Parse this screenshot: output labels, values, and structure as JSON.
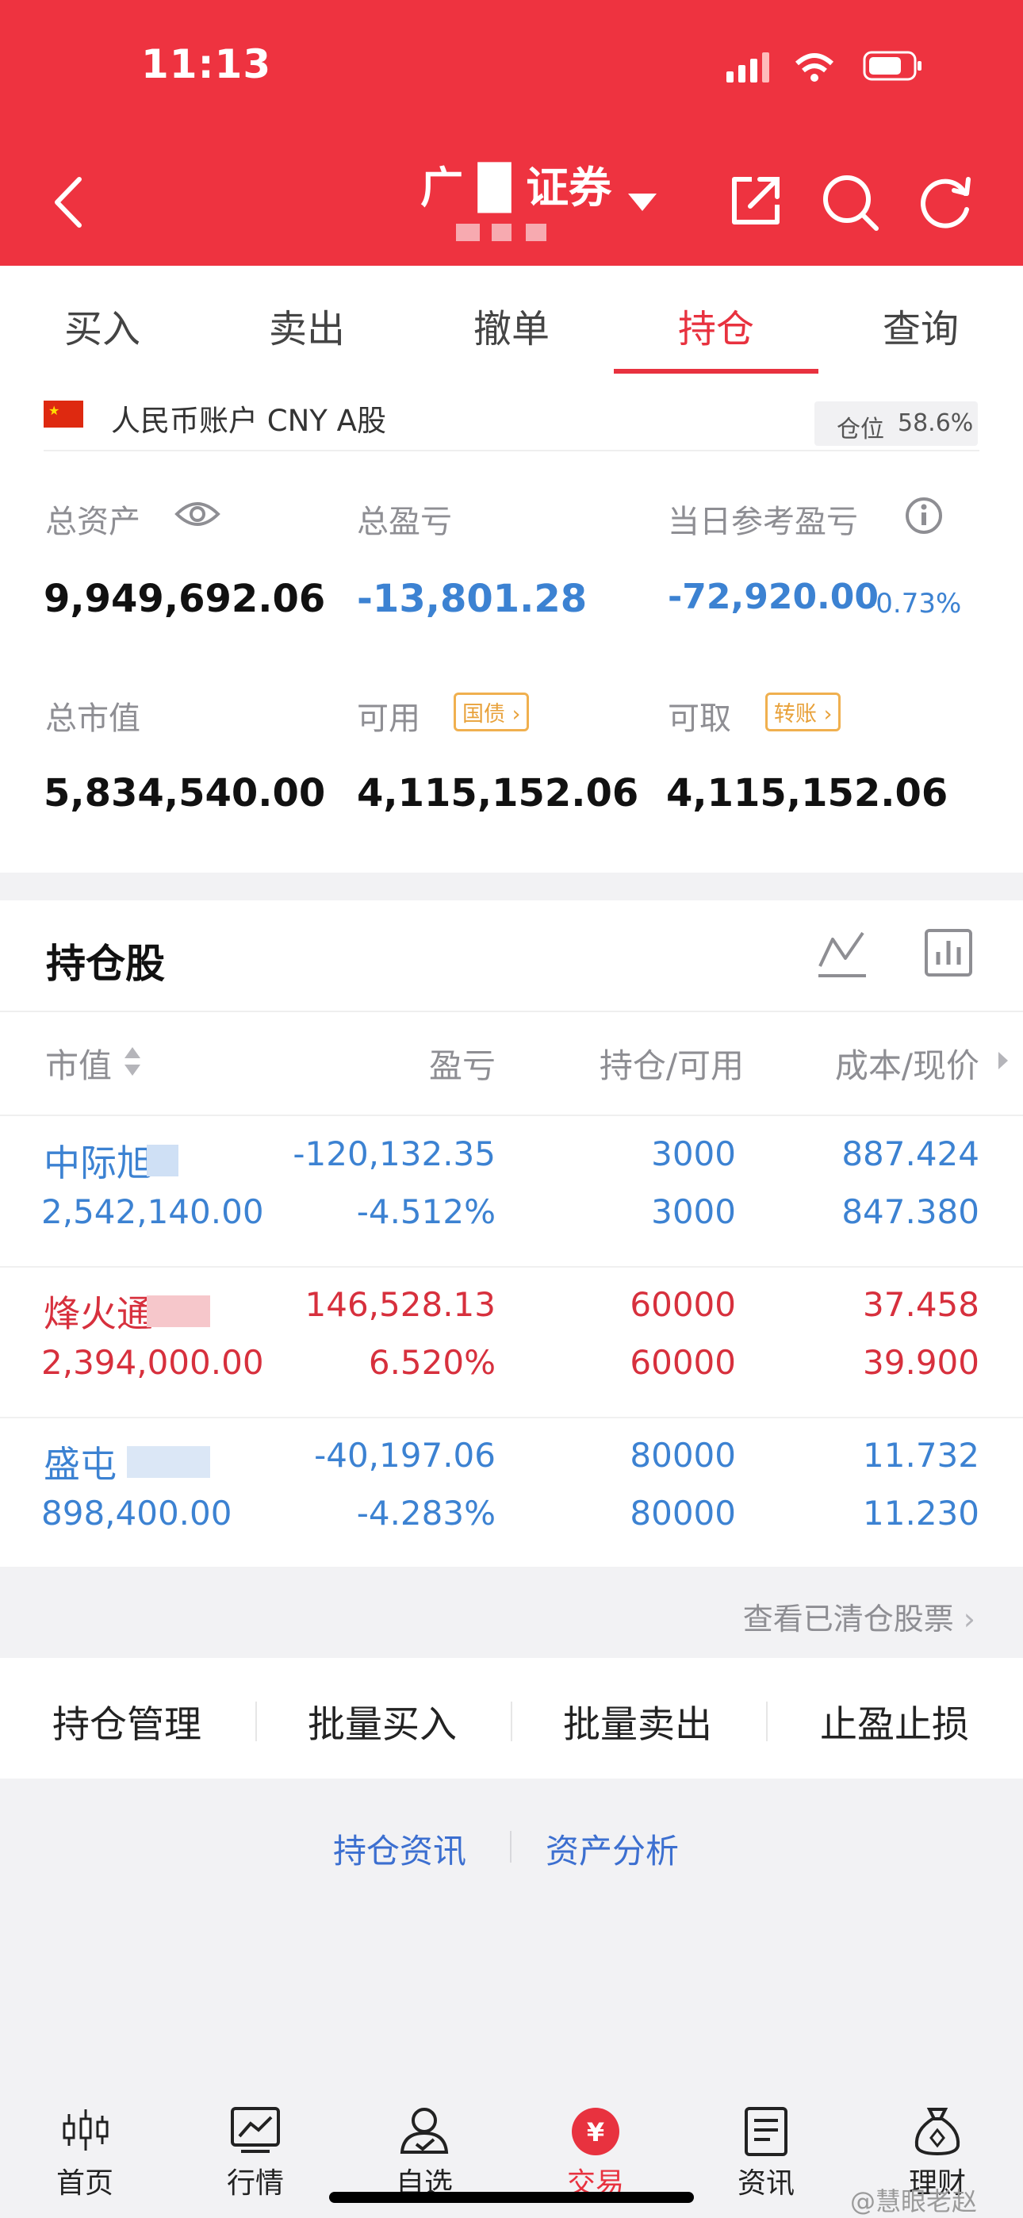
{
  "status": {
    "time": "11:13"
  },
  "header": {
    "title": "广 █ 证券"
  },
  "tabs": [
    {
      "label": "买入",
      "active": false
    },
    {
      "label": "卖出",
      "active": false
    },
    {
      "label": "撤单",
      "active": false
    },
    {
      "label": "持仓",
      "active": true
    },
    {
      "label": "查询",
      "active": false
    }
  ],
  "account": {
    "label": "人民币账户 CNY A股",
    "position_label": "仓位",
    "position_value": "58.6%"
  },
  "metrics": {
    "total_assets_label": "总资产",
    "total_assets": "9,949,692.06",
    "total_pnl_label": "总盈亏",
    "total_pnl": "-13,801.28",
    "daily_pnl_label": "当日参考盈亏",
    "daily_pnl": "-72,920.00",
    "daily_pnl_pct": "-0.73%",
    "market_value_label": "总市值",
    "market_value": "5,834,540.00",
    "available_label": "可用",
    "available_tag": "国债",
    "available": "4,115,152.06",
    "withdrawable_label": "可取",
    "withdrawable_tag": "转账",
    "withdrawable": "4,115,152.06"
  },
  "holdings": {
    "title": "持仓股",
    "columns": [
      "市值",
      "盈亏",
      "持仓/可用",
      "成本/现价"
    ],
    "rows": [
      {
        "name": "中际旭",
        "market_value": "2,542,140.00",
        "pnl": "-120,132.35",
        "pnl_pct": "-4.512%",
        "position": "3000",
        "available": "3000",
        "cost": "887.424",
        "price": "847.380",
        "trend": "down"
      },
      {
        "name": "烽火通",
        "market_value": "2,394,000.00",
        "pnl": "146,528.13",
        "pnl_pct": "6.520%",
        "position": "60000",
        "available": "60000",
        "cost": "37.458",
        "price": "39.900",
        "trend": "up"
      },
      {
        "name": "盛屯",
        "market_value": "898,400.00",
        "pnl": "-40,197.06",
        "pnl_pct": "-4.283%",
        "position": "80000",
        "available": "80000",
        "cost": "11.732",
        "price": "11.230",
        "trend": "down"
      }
    ],
    "view_cleared": "查看已清仓股票"
  },
  "actions": [
    "持仓管理",
    "批量买入",
    "批量卖出",
    "止盈止损"
  ],
  "links": [
    "持仓资讯",
    "资产分析"
  ],
  "nav": [
    {
      "label": "首页",
      "icon": "home-candlestick-icon"
    },
    {
      "label": "行情",
      "icon": "market-chart-icon"
    },
    {
      "label": "自选",
      "icon": "watchlist-person-icon"
    },
    {
      "label": "交易",
      "icon": "trade-yuan-icon",
      "active": true
    },
    {
      "label": "资讯",
      "icon": "news-doc-icon"
    },
    {
      "label": "理财",
      "icon": "wealth-bag-icon"
    }
  ],
  "watermark": "@慧眼老赵",
  "colors": {
    "brand_red": "#ee3340",
    "up": "#d7303d",
    "down": "#3c82d2",
    "tag": "#f0b04f"
  }
}
